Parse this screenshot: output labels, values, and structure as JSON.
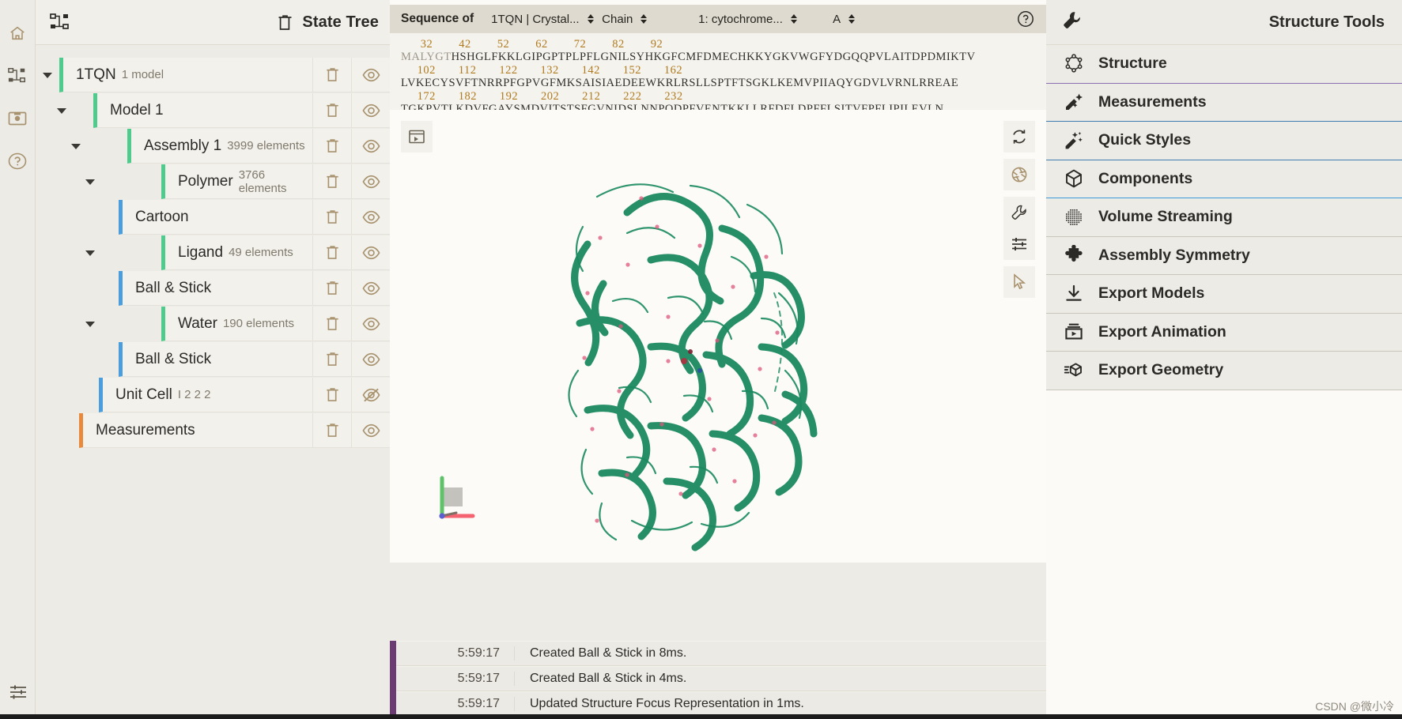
{
  "rail": {
    "items": [
      {
        "name": "home-icon",
        "label": "Home"
      },
      {
        "name": "state-tree-icon",
        "label": "State Tree"
      },
      {
        "name": "save-snapshot-icon",
        "label": "Snapshots"
      },
      {
        "name": "help-icon",
        "label": "Help"
      }
    ],
    "bottom": {
      "name": "settings-sliders-icon",
      "label": "Settings"
    }
  },
  "state_tree": {
    "header_title": "State Tree",
    "header_left_icon": "state-tree-icon",
    "header_remove_icon": "trash-icon",
    "nodes": [
      {
        "label": "1TQN",
        "sub": "1 model",
        "indent": 0,
        "caret": true,
        "accent": "#4ecb8d",
        "visible": true
      },
      {
        "label": "Model 1",
        "sub": "",
        "indent": 1,
        "caret": true,
        "accent": "#4ecb8d",
        "visible": true
      },
      {
        "label": "Assembly 1",
        "sub": "3999 elements",
        "indent": 2,
        "caret": true,
        "accent": "#4ecb8d",
        "visible": true
      },
      {
        "label": "Polymer",
        "sub": "3766 elements",
        "indent": 3,
        "caret": true,
        "accent": "#4ecb8d",
        "visible": true
      },
      {
        "label": "Cartoon",
        "sub": "",
        "indent": 3,
        "caret": false,
        "accent": "#4a9ede",
        "visible": true
      },
      {
        "label": "Ligand",
        "sub": "49 elements",
        "indent": 3,
        "caret": true,
        "accent": "#4ecb8d",
        "visible": true
      },
      {
        "label": "Ball & Stick",
        "sub": "",
        "indent": 3,
        "caret": false,
        "accent": "#4a9ede",
        "visible": true
      },
      {
        "label": "Water",
        "sub": "190 elements",
        "indent": 3,
        "caret": true,
        "accent": "#4ecb8d",
        "visible": true
      },
      {
        "label": "Ball & Stick",
        "sub": "",
        "indent": 3,
        "caret": false,
        "accent": "#4a9ede",
        "visible": true
      },
      {
        "label": "Unit Cell",
        "sub": "I 2 2 2",
        "indent": 2,
        "caret": false,
        "accent": "#4a9ede",
        "visible": false
      },
      {
        "label": "Measurements",
        "sub": "",
        "indent": 1,
        "caret": false,
        "accent": "#e8893c",
        "visible": true
      }
    ]
  },
  "sequence": {
    "header_label": "Sequence of",
    "entry": "1TQN | Crystal...",
    "chain_label": "Chain",
    "polymer": "1: cytochrome...",
    "chain": "A",
    "help_icon": "question-circle-icon",
    "lines": [
      {
        "numbers": "      32        42        52        62        72        82        92",
        "residues": "MALYGTHSHGLFKKLGIPGPTPLPFLGNILSYHKGFCMFDMECHKKYGKVWGFYDGQQPVLAITDPDMIKTV",
        "dim_prefix": "MALYGT"
      },
      {
        "numbers": "     102       112       122       132       142       152       162",
        "residues": "LVKECYSVFTNRRPFGPVGFMKSAISIAEDEEWKRLRSLLSPTFTSGKLKEMVPIIAQYGDVLVRNLRREAE",
        "dim_prefix": ""
      },
      {
        "numbers": "     172       182       192       202       212       222       232",
        "residues": "TGKPVTLKDVFGAYSMDVITSTSFGVNIDSLNNPQDPFVENTKKLLRFDFLDPFFLSITVFPFLIPILEVLN",
        "dim_prefix": ""
      }
    ]
  },
  "viewport": {
    "left_button_icon": "screenshot-icon",
    "right_buttons": [
      {
        "icon": "reset-camera-icon"
      },
      {
        "icon": "aperture-icon"
      },
      {
        "icon": "wrench-icon"
      },
      {
        "icon": "sliders-icon"
      },
      {
        "icon": "cursor-icon"
      }
    ],
    "axes": {
      "x_color": "#f4636f",
      "y_color": "#5ec26a",
      "z_color": "#5a5fd0"
    },
    "structure_color": "#1b8a60"
  },
  "log": {
    "entries": [
      {
        "time": "5:59:17",
        "message": "Created Ball & Stick in 8ms."
      },
      {
        "time": "5:59:17",
        "message": "Created Ball & Stick in 4ms."
      },
      {
        "time": "5:59:17",
        "message": "Updated Structure Focus Representation in 1ms."
      }
    ],
    "accent": "#6b3b73"
  },
  "structure_tools": {
    "title": "Structure Tools",
    "header_icon": "wrench-icon",
    "items": [
      {
        "label": "Structure",
        "icon": "structure-icon",
        "accent": "accent-purple"
      },
      {
        "label": "Measurements",
        "icon": "measurements-icon",
        "accent": "accent-blue"
      },
      {
        "label": "Quick Styles",
        "icon": "quick-styles-icon",
        "accent": "accent-blue"
      },
      {
        "label": "Components",
        "icon": "components-cube-icon",
        "accent": "accent-sky"
      },
      {
        "label": "Volume Streaming",
        "icon": "volume-grid-icon",
        "accent": "accent-grey"
      },
      {
        "label": "Assembly Symmetry",
        "icon": "puzzle-icon",
        "accent": "accent-grey"
      },
      {
        "label": "Export Models",
        "icon": "download-icon",
        "accent": "accent-grey"
      },
      {
        "label": "Export Animation",
        "icon": "animation-icon",
        "accent": "accent-grey"
      },
      {
        "label": "Export Geometry",
        "icon": "geometry-icon",
        "accent": "accent-grey"
      }
    ]
  },
  "watermark": "CSDN @微小冷"
}
